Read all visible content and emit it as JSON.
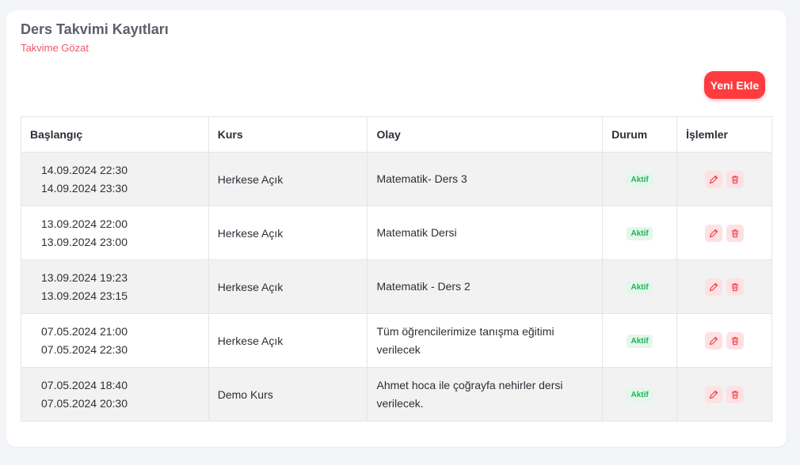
{
  "header": {
    "title": "Ders Takvimi Kayıtları",
    "subtitle": "Takvime Gözat",
    "add_label": "Yeni Ekle"
  },
  "table": {
    "columns": [
      "Başlangıç",
      "Kurs",
      "Olay",
      "Durum",
      "İşlemler"
    ],
    "rows": [
      {
        "start": "14.09.2024 22:30",
        "end": "14.09.2024 23:30",
        "course": "Herkese Açık",
        "event": "Matematik- Ders 3",
        "status": "Aktif"
      },
      {
        "start": "13.09.2024 22:00",
        "end": "13.09.2024 23:00",
        "course": "Herkese Açık",
        "event": "Matematik Dersi",
        "status": "Aktif"
      },
      {
        "start": "13.09.2024 19:23",
        "end": "13.09.2024 23:15",
        "course": "Herkese Açık",
        "event": "Matematik - Ders 2",
        "status": "Aktif"
      },
      {
        "start": "07.05.2024 21:00",
        "end": "07.05.2024 22:30",
        "course": "Herkese Açık",
        "event": "Tüm öğrencilerimize tanışma eğitimi verilecek",
        "status": "Aktif"
      },
      {
        "start": "07.05.2024 18:40",
        "end": "07.05.2024 20:30",
        "course": "Demo Kurs",
        "event": "Ahmet hoca ile çoğrayfa nehirler dersi verilecek.",
        "status": "Aktif"
      }
    ]
  },
  "icons": {
    "edit": "pencil-icon",
    "delete": "trash-icon"
  },
  "colors": {
    "accent": "#ff3b3f",
    "subtitle": "#f0566a",
    "status_text": "#1bb35a",
    "status_bg": "#e3f7ea",
    "action_bg": "#fde1e3"
  }
}
